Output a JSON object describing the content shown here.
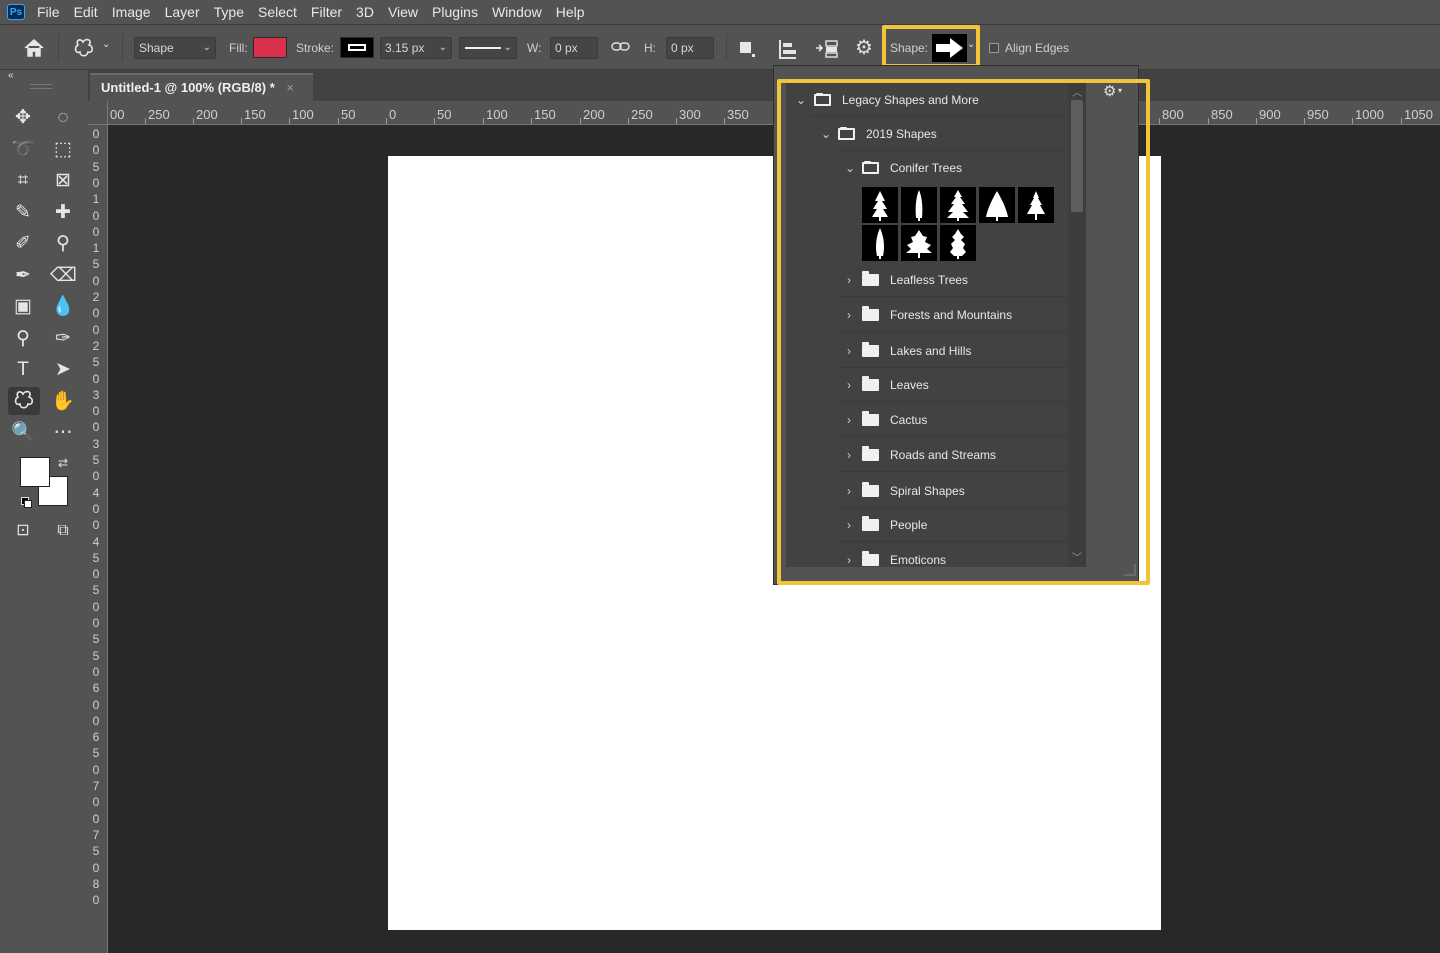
{
  "app": {
    "logo_text": "Ps"
  },
  "menu": [
    "File",
    "Edit",
    "Image",
    "Layer",
    "Type",
    "Select",
    "Filter",
    "3D",
    "View",
    "Plugins",
    "Window",
    "Help"
  ],
  "options_bar": {
    "mode_select": "Shape",
    "fill_label": "Fill:",
    "fill_color": "#d9304b",
    "stroke_label": "Stroke:",
    "stroke_width": "3.15 px",
    "w_label": "W:",
    "w_value": "0 px",
    "h_label": "H:",
    "h_value": "0 px",
    "shape_label": "Shape:",
    "align_edges_label": "Align Edges",
    "align_edges_checked": false
  },
  "document_tab": {
    "title": "Untitled-1 @ 100% (RGB/8) *",
    "close": "×"
  },
  "rulers": {
    "horizontal": [
      "00",
      "250",
      "200",
      "150",
      "100",
      "50",
      "0",
      "50",
      "100",
      "150",
      "200",
      "250",
      "300",
      "350",
      "800",
      "850",
      "900",
      "950",
      "1000",
      "1050"
    ],
    "vertical": [
      "0",
      "0",
      "5",
      "0",
      "1",
      "0",
      "0",
      "1",
      "5",
      "0",
      "2",
      "0",
      "0",
      "2",
      "5",
      "0",
      "3",
      "0",
      "0",
      "3",
      "5",
      "0",
      "4",
      "0",
      "0",
      "4",
      "5",
      "0",
      "5",
      "0",
      "0",
      "5",
      "5",
      "0",
      "6",
      "0",
      "0",
      "6",
      "5",
      "0",
      "7",
      "0",
      "0",
      "7",
      "5",
      "0",
      "8",
      "0"
    ]
  },
  "shape_picker": {
    "root": "Legacy Shapes and More",
    "group": "2019 Shapes",
    "open_folder": "Conifer Trees",
    "thumbnails": [
      "conifer-tree-1",
      "conifer-tree-2",
      "conifer-tree-3",
      "conifer-tree-4",
      "conifer-tree-5",
      "conifer-tree-6",
      "conifer-tree-7",
      "conifer-tree-8"
    ],
    "folders": [
      "Leafless Trees",
      "Forests and Mountains",
      "Lakes and Hills",
      "Leaves",
      "Cactus",
      "Roads and Streams",
      "Spiral Shapes",
      "People",
      "Emoticons"
    ]
  },
  "colors": {
    "highlight": "#f0c43b",
    "foreground": "#ffffff",
    "background": "#ffffff"
  }
}
